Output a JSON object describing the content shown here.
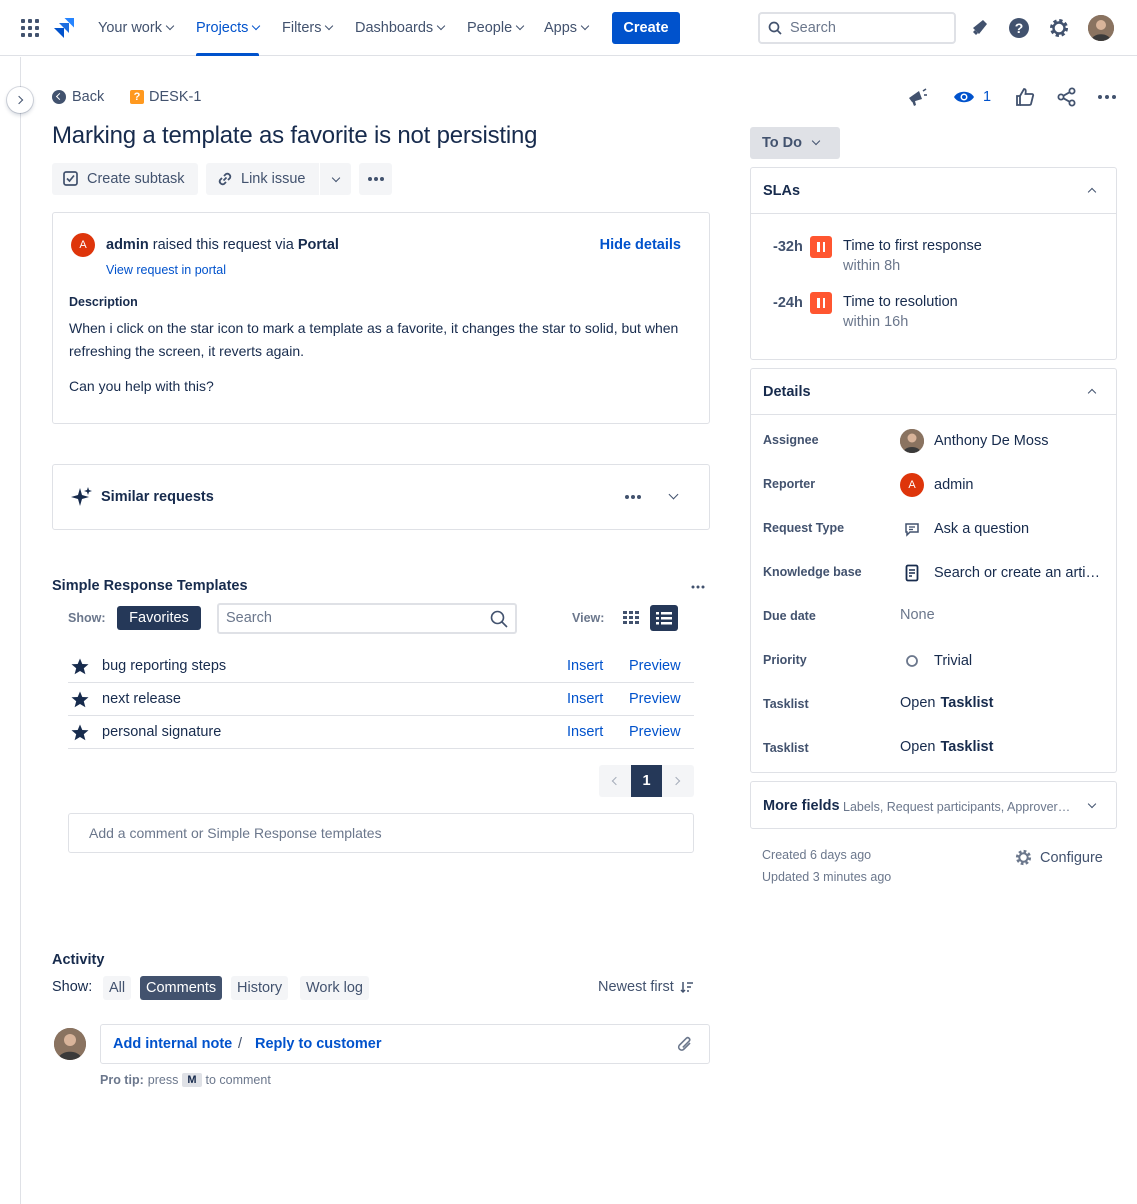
{
  "nav": {
    "items": [
      "Your work",
      "Projects",
      "Filters",
      "Dashboards",
      "People",
      "Apps"
    ],
    "active": "Projects",
    "create_label": "Create",
    "search_placeholder": "Search",
    "accent": "#0052cc"
  },
  "issue": {
    "back_label": "Back",
    "key": "DESK-1",
    "title": "Marking a template as favorite is not persisting",
    "watchers": "1",
    "actions": {
      "create_subtask": "Create subtask",
      "link_issue": "Link issue"
    }
  },
  "request": {
    "raiser_initial": "A",
    "raiser": "admin",
    "raised_text": "raised this request via",
    "channel": "Portal",
    "hide_details": "Hide details",
    "view_portal": "View request in portal",
    "description_label": "Description",
    "description_p1": "When i click on the star icon to mark a template as a favorite, it changes the star to solid, but when refreshing the screen, it reverts again.",
    "description_p2": "Can you help with this?"
  },
  "similar": {
    "label": "Similar requests"
  },
  "templates": {
    "title": "Simple Response Templates",
    "show_label": "Show:",
    "filter": "Favorites",
    "search_placeholder": "Search",
    "view_label": "View:",
    "rows": [
      {
        "name": "bug reporting steps",
        "insert": "Insert",
        "preview": "Preview"
      },
      {
        "name": "next release",
        "insert": "Insert",
        "preview": "Preview"
      },
      {
        "name": "personal signature",
        "insert": "Insert",
        "preview": "Preview"
      }
    ],
    "page": "1",
    "comment_placeholder": "Add a comment or Simple Response templates"
  },
  "activity": {
    "title": "Activity",
    "show_label": "Show:",
    "filters": [
      "All",
      "Comments",
      "History",
      "Work log"
    ],
    "selected": "Comments",
    "sort": "Newest first",
    "add_internal_note": "Add internal note",
    "separator": "/",
    "reply_customer": "Reply to customer",
    "pro_tip_label": "Pro tip:",
    "pro_tip_pre": "press",
    "pro_tip_key": "M",
    "pro_tip_post": "to comment"
  },
  "status": {
    "label": "To Do"
  },
  "slas": {
    "title": "SLAs",
    "items": [
      {
        "value": "-32h",
        "name": "Time to first response",
        "sub": "within 8h",
        "color": "#ff5630"
      },
      {
        "value": "-24h",
        "name": "Time to resolution",
        "sub": "within 16h",
        "color": "#ff5630"
      }
    ]
  },
  "details": {
    "title": "Details",
    "fields": [
      {
        "label": "Assignee",
        "value": "Anthony De Moss",
        "icon": "avatar-photo"
      },
      {
        "label": "Reporter",
        "value": "admin",
        "icon": "avatar-letter"
      },
      {
        "label": "Request Type",
        "value": "Ask a question",
        "icon": "speech-bubble-icon"
      },
      {
        "label": "Knowledge base",
        "value": "Search or create an arti…",
        "icon": "knowledge-base-icon"
      },
      {
        "label": "Due date",
        "value": "None",
        "icon": ""
      },
      {
        "label": "Priority",
        "value": "Trivial",
        "icon": "priority-circle-icon"
      },
      {
        "label": "Tasklist",
        "value_prefix": "Open",
        "value": "Tasklist",
        "icon": ""
      },
      {
        "label": "Tasklist",
        "value_prefix": "Open",
        "value": "Tasklist",
        "icon": ""
      }
    ]
  },
  "more_fields": {
    "title": "More fields",
    "hint": "Labels, Request participants, Approver…"
  },
  "meta": {
    "created": "Created 6 days ago",
    "updated": "Updated 3 minutes ago",
    "configure": "Configure"
  }
}
